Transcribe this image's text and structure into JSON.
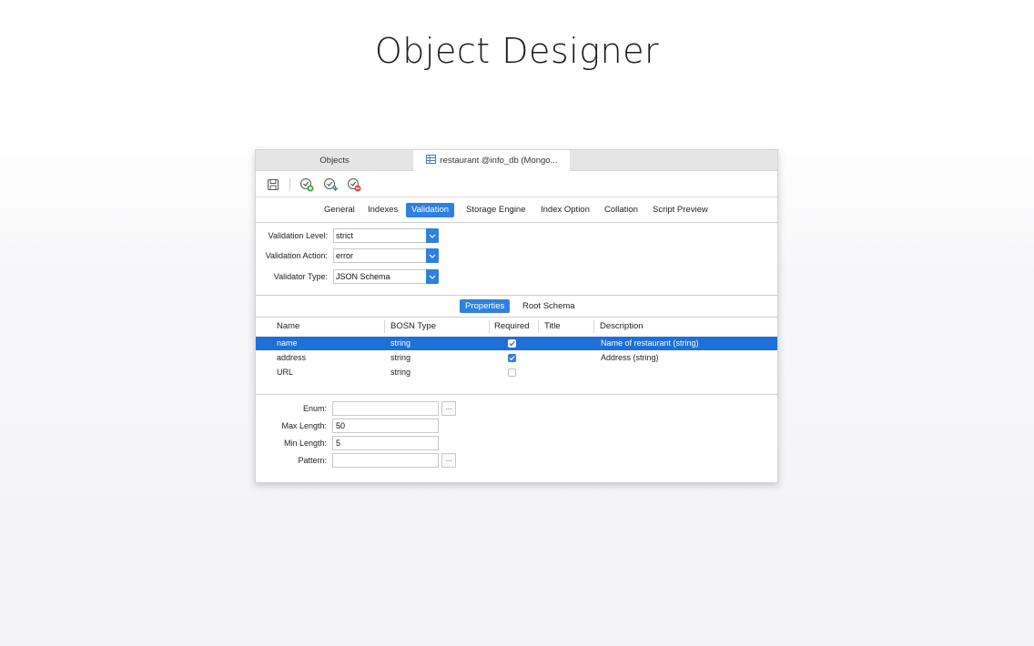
{
  "page_title": "Object Designer",
  "tabs": {
    "objects_label": "Objects",
    "active_label": "restaurant @info_db (Mongo..."
  },
  "toolbar": {
    "icons": [
      "save-icon",
      "validate-add-icon",
      "validate-import-icon",
      "validate-remove-icon"
    ]
  },
  "subtabs": [
    "General",
    "Indexes",
    "Validation",
    "Storage Engine",
    "Index Option",
    "Collation",
    "Script Preview"
  ],
  "subtab_active": "Validation",
  "validation": {
    "level_label": "Validation Level:",
    "level_value": "strict",
    "action_label": "Validation Action:",
    "action_value": "error",
    "type_label": "Validator Type:",
    "type_value": "JSON Schema"
  },
  "schema_tabs": [
    "Properties",
    "Root Schema"
  ],
  "schema_tab_active": "Properties",
  "grid": {
    "headers": [
      "Name",
      "BOSN Type",
      "Required",
      "Title",
      "Description"
    ],
    "rows": [
      {
        "name": "name",
        "type": "string",
        "required": true,
        "title": "",
        "description": "Name of restaurant (string)",
        "selected": true
      },
      {
        "name": "address",
        "type": "string",
        "required": true,
        "title": "",
        "description": "Address (string)",
        "selected": false
      },
      {
        "name": "URL",
        "type": "string",
        "required": false,
        "title": "",
        "description": "",
        "selected": false
      }
    ]
  },
  "details": {
    "enum_label": "Enum:",
    "enum_value": "",
    "max_length_label": "Max Length:",
    "max_length_value": "50",
    "min_length_label": "Min Length:",
    "min_length_value": "5",
    "pattern_label": "Pattern:",
    "pattern_value": "",
    "ellipsis": "..."
  },
  "colors": {
    "accent": "#2f80e0",
    "selected_row": "#1e6fd6"
  }
}
